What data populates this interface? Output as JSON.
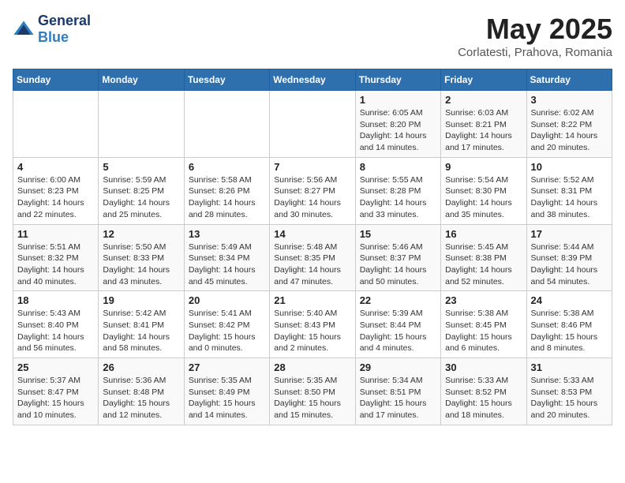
{
  "header": {
    "logo_line1": "General",
    "logo_line2": "Blue",
    "month_title": "May 2025",
    "location": "Corlatesti, Prahova, Romania"
  },
  "weekdays": [
    "Sunday",
    "Monday",
    "Tuesday",
    "Wednesday",
    "Thursday",
    "Friday",
    "Saturday"
  ],
  "weeks": [
    [
      {
        "day": "",
        "info": ""
      },
      {
        "day": "",
        "info": ""
      },
      {
        "day": "",
        "info": ""
      },
      {
        "day": "",
        "info": ""
      },
      {
        "day": "1",
        "info": "Sunrise: 6:05 AM\nSunset: 8:20 PM\nDaylight: 14 hours\nand 14 minutes."
      },
      {
        "day": "2",
        "info": "Sunrise: 6:03 AM\nSunset: 8:21 PM\nDaylight: 14 hours\nand 17 minutes."
      },
      {
        "day": "3",
        "info": "Sunrise: 6:02 AM\nSunset: 8:22 PM\nDaylight: 14 hours\nand 20 minutes."
      }
    ],
    [
      {
        "day": "4",
        "info": "Sunrise: 6:00 AM\nSunset: 8:23 PM\nDaylight: 14 hours\nand 22 minutes."
      },
      {
        "day": "5",
        "info": "Sunrise: 5:59 AM\nSunset: 8:25 PM\nDaylight: 14 hours\nand 25 minutes."
      },
      {
        "day": "6",
        "info": "Sunrise: 5:58 AM\nSunset: 8:26 PM\nDaylight: 14 hours\nand 28 minutes."
      },
      {
        "day": "7",
        "info": "Sunrise: 5:56 AM\nSunset: 8:27 PM\nDaylight: 14 hours\nand 30 minutes."
      },
      {
        "day": "8",
        "info": "Sunrise: 5:55 AM\nSunset: 8:28 PM\nDaylight: 14 hours\nand 33 minutes."
      },
      {
        "day": "9",
        "info": "Sunrise: 5:54 AM\nSunset: 8:30 PM\nDaylight: 14 hours\nand 35 minutes."
      },
      {
        "day": "10",
        "info": "Sunrise: 5:52 AM\nSunset: 8:31 PM\nDaylight: 14 hours\nand 38 minutes."
      }
    ],
    [
      {
        "day": "11",
        "info": "Sunrise: 5:51 AM\nSunset: 8:32 PM\nDaylight: 14 hours\nand 40 minutes."
      },
      {
        "day": "12",
        "info": "Sunrise: 5:50 AM\nSunset: 8:33 PM\nDaylight: 14 hours\nand 43 minutes."
      },
      {
        "day": "13",
        "info": "Sunrise: 5:49 AM\nSunset: 8:34 PM\nDaylight: 14 hours\nand 45 minutes."
      },
      {
        "day": "14",
        "info": "Sunrise: 5:48 AM\nSunset: 8:35 PM\nDaylight: 14 hours\nand 47 minutes."
      },
      {
        "day": "15",
        "info": "Sunrise: 5:46 AM\nSunset: 8:37 PM\nDaylight: 14 hours\nand 50 minutes."
      },
      {
        "day": "16",
        "info": "Sunrise: 5:45 AM\nSunset: 8:38 PM\nDaylight: 14 hours\nand 52 minutes."
      },
      {
        "day": "17",
        "info": "Sunrise: 5:44 AM\nSunset: 8:39 PM\nDaylight: 14 hours\nand 54 minutes."
      }
    ],
    [
      {
        "day": "18",
        "info": "Sunrise: 5:43 AM\nSunset: 8:40 PM\nDaylight: 14 hours\nand 56 minutes."
      },
      {
        "day": "19",
        "info": "Sunrise: 5:42 AM\nSunset: 8:41 PM\nDaylight: 14 hours\nand 58 minutes."
      },
      {
        "day": "20",
        "info": "Sunrise: 5:41 AM\nSunset: 8:42 PM\nDaylight: 15 hours\nand 0 minutes."
      },
      {
        "day": "21",
        "info": "Sunrise: 5:40 AM\nSunset: 8:43 PM\nDaylight: 15 hours\nand 2 minutes."
      },
      {
        "day": "22",
        "info": "Sunrise: 5:39 AM\nSunset: 8:44 PM\nDaylight: 15 hours\nand 4 minutes."
      },
      {
        "day": "23",
        "info": "Sunrise: 5:38 AM\nSunset: 8:45 PM\nDaylight: 15 hours\nand 6 minutes."
      },
      {
        "day": "24",
        "info": "Sunrise: 5:38 AM\nSunset: 8:46 PM\nDaylight: 15 hours\nand 8 minutes."
      }
    ],
    [
      {
        "day": "25",
        "info": "Sunrise: 5:37 AM\nSunset: 8:47 PM\nDaylight: 15 hours\nand 10 minutes."
      },
      {
        "day": "26",
        "info": "Sunrise: 5:36 AM\nSunset: 8:48 PM\nDaylight: 15 hours\nand 12 minutes."
      },
      {
        "day": "27",
        "info": "Sunrise: 5:35 AM\nSunset: 8:49 PM\nDaylight: 15 hours\nand 14 minutes."
      },
      {
        "day": "28",
        "info": "Sunrise: 5:35 AM\nSunset: 8:50 PM\nDaylight: 15 hours\nand 15 minutes."
      },
      {
        "day": "29",
        "info": "Sunrise: 5:34 AM\nSunset: 8:51 PM\nDaylight: 15 hours\nand 17 minutes."
      },
      {
        "day": "30",
        "info": "Sunrise: 5:33 AM\nSunset: 8:52 PM\nDaylight: 15 hours\nand 18 minutes."
      },
      {
        "day": "31",
        "info": "Sunrise: 5:33 AM\nSunset: 8:53 PM\nDaylight: 15 hours\nand 20 minutes."
      }
    ]
  ]
}
